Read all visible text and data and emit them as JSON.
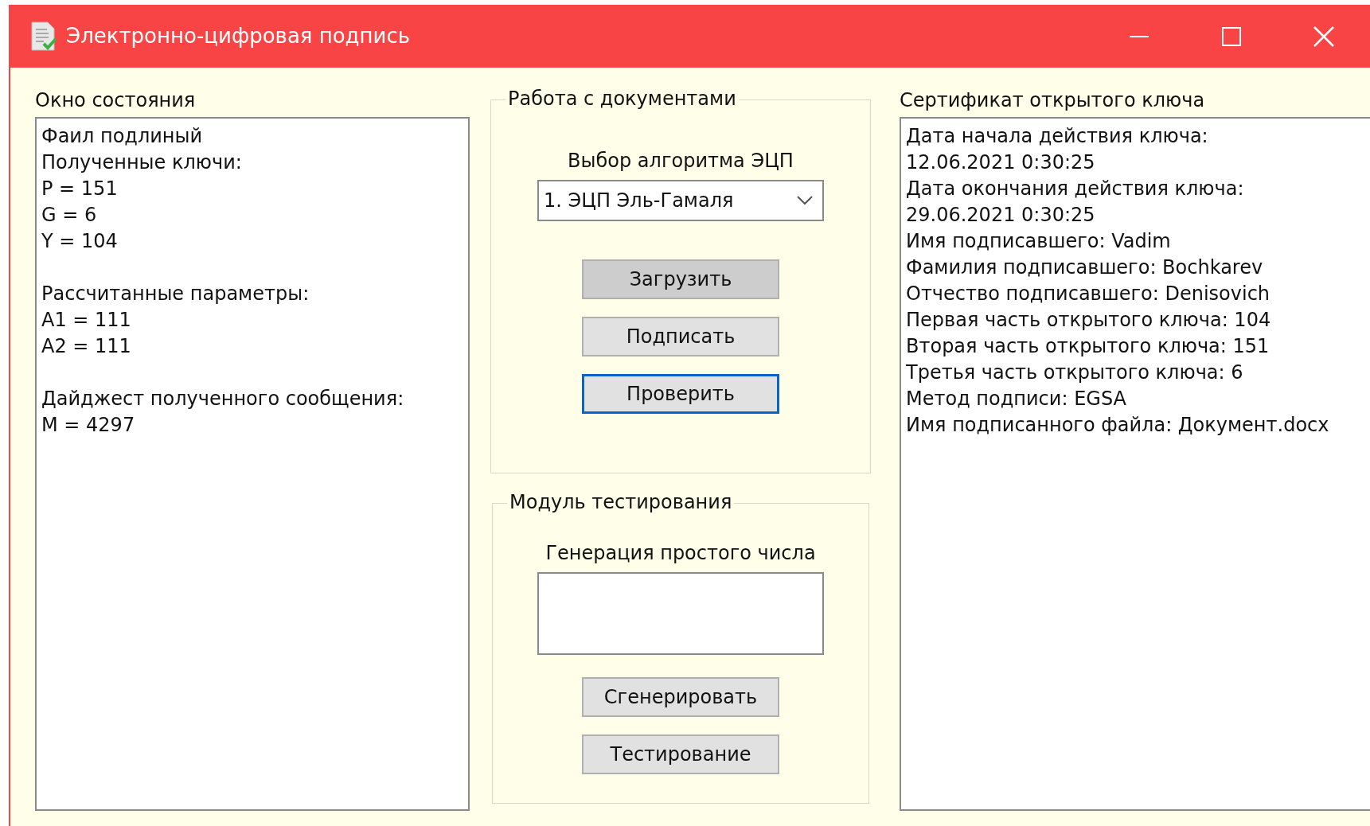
{
  "window": {
    "title": "Электронно-цифровая подпись"
  },
  "status_panel": {
    "label": "Окно состояния",
    "paragraphs": [
      [
        "Фаил подлиный",
        "Полученные ключи:",
        "P = 151",
        "G = 6",
        "Y = 104"
      ],
      [
        "Рассчитанные параметры:",
        "A1 = 111",
        "A2 = 111"
      ],
      [
        "Дайджест полученного сообщения:",
        "M = 4297"
      ]
    ]
  },
  "documents_group": {
    "title": "Работа с документами",
    "algorithm_label": "Выбор алгоритма ЭЦП",
    "algorithm_select": {
      "value": "1. ЭЦП Эль-Гамаля"
    },
    "buttons": [
      {
        "label": "Загрузить",
        "hovered": true,
        "focused": false
      },
      {
        "label": "Подписать",
        "hovered": false,
        "focused": false
      },
      {
        "label": "Проверить",
        "hovered": false,
        "focused": true
      }
    ]
  },
  "testing_group": {
    "title": "Модуль тестирования",
    "prime_label": "Генерация простого числа",
    "buttons": [
      {
        "label": "Сгенерировать",
        "hovered": false,
        "focused": false
      },
      {
        "label": "Тестирование",
        "hovered": false,
        "focused": false
      }
    ]
  },
  "certificate": {
    "label": "Сертификат открытого ключа",
    "lines": [
      "Дата начала действия ключа:",
      "12.06.2021 0:30:25",
      "Дата окончания действия ключа:",
      "29.06.2021 0:30:25",
      "Имя подписавшего: Vadim",
      "Фамилия подписавшего: Bochkarev",
      "Отчество подписавшего: Denisovich",
      "Первая часть открытого ключа: 104",
      "Вторая часть открытого ключа: 151",
      "Третья часть открытого ключа: 6",
      "Метод подписи: EGSA",
      "Имя подписанного файла: Документ.docx"
    ]
  }
}
